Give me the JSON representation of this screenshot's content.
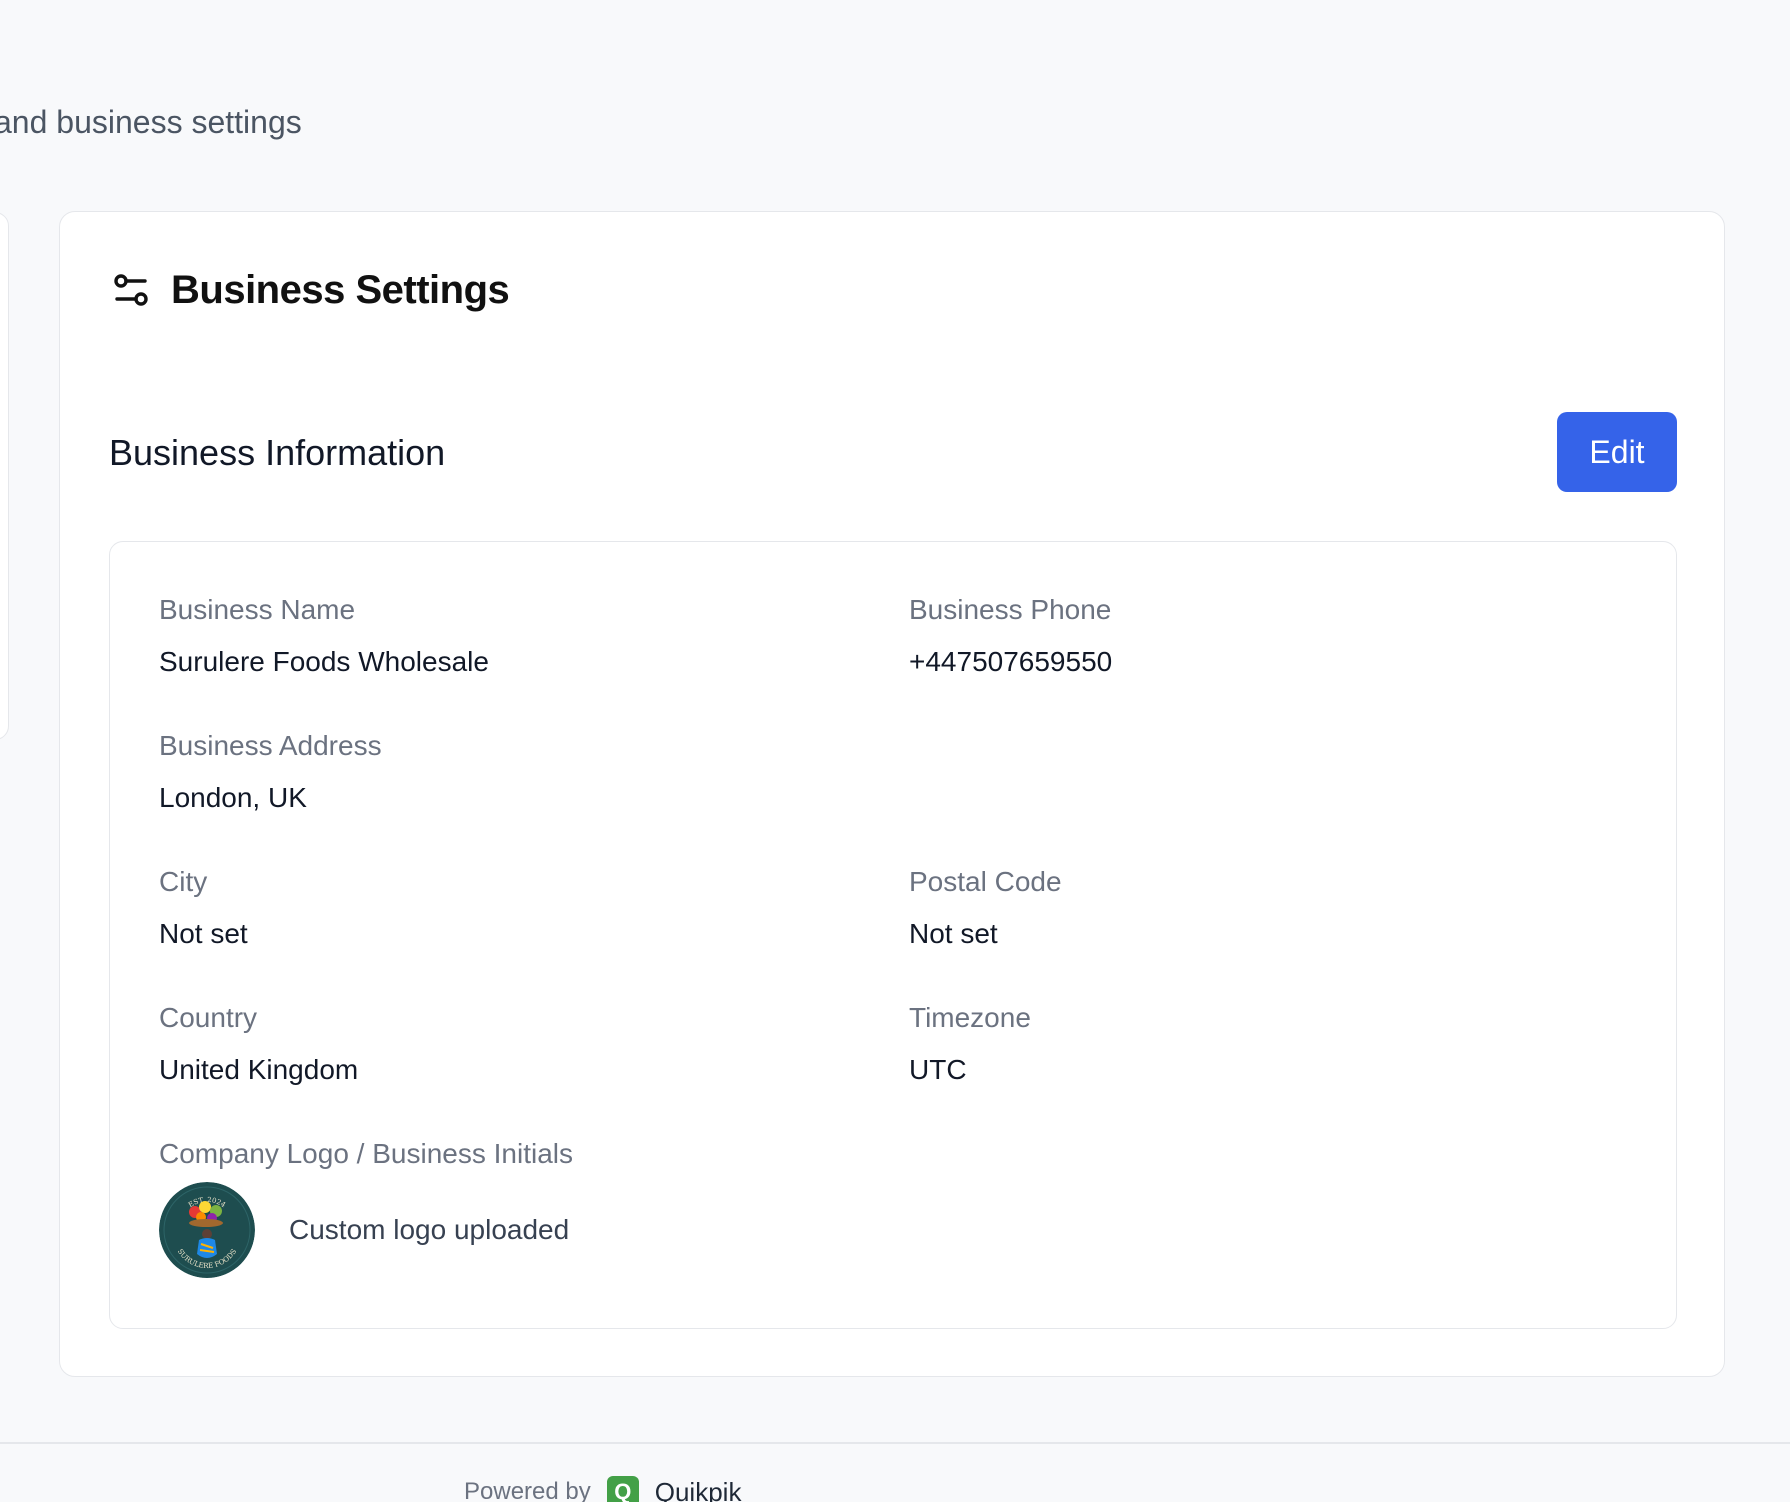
{
  "page": {
    "subtitle": "and business settings"
  },
  "settings_card": {
    "title": "Business Settings",
    "icon": "settings-sliders-icon"
  },
  "business_info": {
    "section_title": "Business Information",
    "edit_label": "Edit",
    "fields": {
      "business_name": {
        "label": "Business Name",
        "value": "Surulere Foods Wholesale"
      },
      "business_phone": {
        "label": "Business Phone",
        "value": "+447507659550"
      },
      "business_address": {
        "label": "Business Address",
        "value": "London, UK"
      },
      "city": {
        "label": "City",
        "value": "Not set"
      },
      "postal_code": {
        "label": "Postal Code",
        "value": "Not set"
      },
      "country": {
        "label": "Country",
        "value": "United Kingdom"
      },
      "timezone": {
        "label": "Timezone",
        "value": "UTC"
      }
    },
    "logo": {
      "label": "Company Logo / Business Initials",
      "status": "Custom logo uploaded",
      "logo_top_text": "EST. 2024",
      "logo_bottom_text": "SURULERE FOODS"
    }
  },
  "footer": {
    "powered_by": "Powered by",
    "brand_initial": "Q",
    "brand_name": "Quikpik"
  },
  "colors": {
    "accent": "#3563e9",
    "brand_green": "#43a047",
    "logo_bg": "#1e4d4f"
  }
}
